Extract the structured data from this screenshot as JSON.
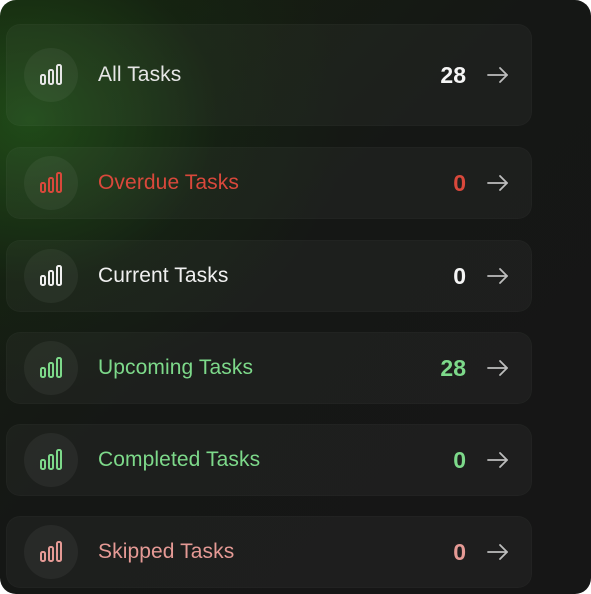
{
  "rows": [
    {
      "label": "All Tasks",
      "count": "28",
      "color": "#e6e6e6",
      "icon": "signal-bars-icon"
    },
    {
      "label": "Overdue Tasks",
      "count": "0",
      "color": "#d9483b",
      "icon": "signal-bars-icon"
    },
    {
      "label": "Current Tasks",
      "count": "0",
      "color": "#f0f0f0",
      "icon": "signal-bars-icon"
    },
    {
      "label": "Upcoming Tasks",
      "count": "28",
      "color": "#7dd98a",
      "icon": "signal-bars-icon"
    },
    {
      "label": "Completed Tasks",
      "count": "0",
      "color": "#7dd98a",
      "icon": "signal-bars-icon"
    },
    {
      "label": "Skipped Tasks",
      "count": "0",
      "color": "#e59a95",
      "icon": "signal-bars-icon"
    }
  ],
  "arrow_icon": "arrow-right-icon"
}
